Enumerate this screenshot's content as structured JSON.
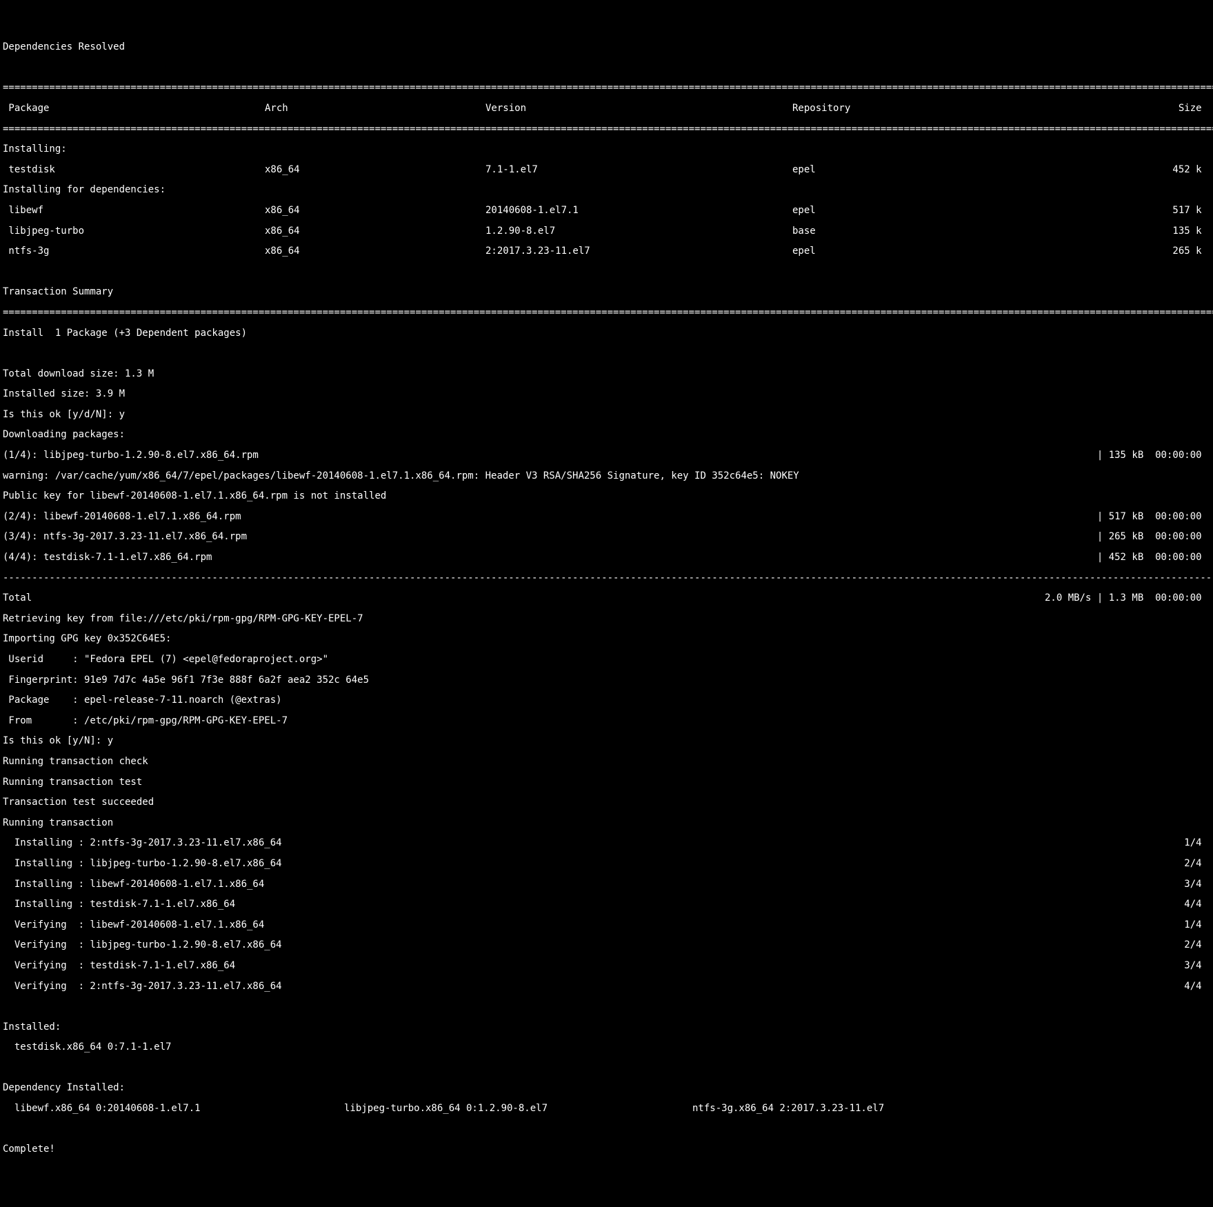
{
  "header": {
    "deps_resolved": "Dependencies Resolved",
    "rule": "=================================================================================================================================================================================================================",
    "cols": {
      "pkg": " Package",
      "arch": "Arch",
      "ver": "Version",
      "repo": "Repository",
      "size": "Size "
    }
  },
  "installing_label": "Installing:",
  "installing": [
    {
      "pkg": " testdisk",
      "arch": "x86_64",
      "ver": "7.1-1.el7",
      "repo": "epel",
      "size": "452 k "
    }
  ],
  "installing_deps_label": "Installing for dependencies:",
  "installing_deps": [
    {
      "pkg": " libewf",
      "arch": "x86_64",
      "ver": "20140608-1.el7.1",
      "repo": "epel",
      "size": "517 k "
    },
    {
      "pkg": " libjpeg-turbo",
      "arch": "x86_64",
      "ver": "1.2.90-8.el7",
      "repo": "base",
      "size": "135 k "
    },
    {
      "pkg": " ntfs-3g",
      "arch": "x86_64",
      "ver": "2:2017.3.23-11.el7",
      "repo": "epel",
      "size": "265 k "
    }
  ],
  "txn_summary_label": "Transaction Summary",
  "install_summary": "Install  1 Package (+3 Dependent packages)",
  "totals": {
    "download": "Total download size: 1.3 M",
    "installed": "Installed size: 3.9 M"
  },
  "prompt1": "Is this ok [y/d/N]: y",
  "downloading": "Downloading packages:",
  "dl1": {
    "left": "(1/4): libjpeg-turbo-1.2.90-8.el7.x86_64.rpm",
    "right": "| 135 kB  00:00:00 "
  },
  "warning": "warning: /var/cache/yum/x86_64/7/epel/packages/libewf-20140608-1.el7.1.x86_64.rpm: Header V3 RSA/SHA256 Signature, key ID 352c64e5: NOKEY",
  "pubkey": "Public key for libewf-20140608-1.el7.1.x86_64.rpm is not installed",
  "dl2": {
    "left": "(2/4): libewf-20140608-1.el7.1.x86_64.rpm",
    "right": "| 517 kB  00:00:00 "
  },
  "dl3": {
    "left": "(3/4): ntfs-3g-2017.3.23-11.el7.x86_64.rpm",
    "right": "| 265 kB  00:00:00 "
  },
  "dl4": {
    "left": "(4/4): testdisk-7.1-1.el7.x86_64.rpm",
    "right": "| 452 kB  00:00:00 "
  },
  "dash_rule": "-----------------------------------------------------------------------------------------------------------------------------------------------------------------------------------------------------------------",
  "total_line": {
    "left": "Total",
    "right": "2.0 MB/s | 1.3 MB  00:00:00 "
  },
  "retrieve": "Retrieving key from file:///etc/pki/rpm-gpg/RPM-GPG-KEY-EPEL-7",
  "importing": "Importing GPG key 0x352C64E5:",
  "userid": " Userid     : \"Fedora EPEL (7) <epel@fedoraproject.org>\"",
  "fingerprint": " Fingerprint: 91e9 7d7c 4a5e 96f1 7f3e 888f 6a2f aea2 352c 64e5",
  "gpg_package": " Package    : epel-release-7-11.noarch (@extras)",
  "from": " From       : /etc/pki/rpm-gpg/RPM-GPG-KEY-EPEL-7",
  "prompt2": "Is this ok [y/N]: y",
  "run_check": "Running transaction check",
  "run_test": "Running transaction test",
  "test_ok": "Transaction test succeeded",
  "run_txn": "Running transaction",
  "progress": [
    {
      "left": "  Installing : 2:ntfs-3g-2017.3.23-11.el7.x86_64",
      "right": "1/4 "
    },
    {
      "left": "  Installing : libjpeg-turbo-1.2.90-8.el7.x86_64",
      "right": "2/4 "
    },
    {
      "left": "  Installing : libewf-20140608-1.el7.1.x86_64",
      "right": "3/4 "
    },
    {
      "left": "  Installing : testdisk-7.1-1.el7.x86_64",
      "right": "4/4 "
    },
    {
      "left": "  Verifying  : libewf-20140608-1.el7.1.x86_64",
      "right": "1/4 "
    },
    {
      "left": "  Verifying  : libjpeg-turbo-1.2.90-8.el7.x86_64",
      "right": "2/4 "
    },
    {
      "left": "  Verifying  : testdisk-7.1-1.el7.x86_64",
      "right": "3/4 "
    },
    {
      "left": "  Verifying  : 2:ntfs-3g-2017.3.23-11.el7.x86_64",
      "right": "4/4 "
    }
  ],
  "installed_label": "Installed:",
  "installed_pkg": "  testdisk.x86_64 0:7.1-1.el7",
  "dep_installed_label": "Dependency Installed:",
  "dep_installed": {
    "c1": "  libewf.x86_64 0:20140608-1.el7.1",
    "c2": "libjpeg-turbo.x86_64 0:1.2.90-8.el7",
    "c3": "ntfs-3g.x86_64 2:2017.3.23-11.el7"
  },
  "complete": "Complete!"
}
